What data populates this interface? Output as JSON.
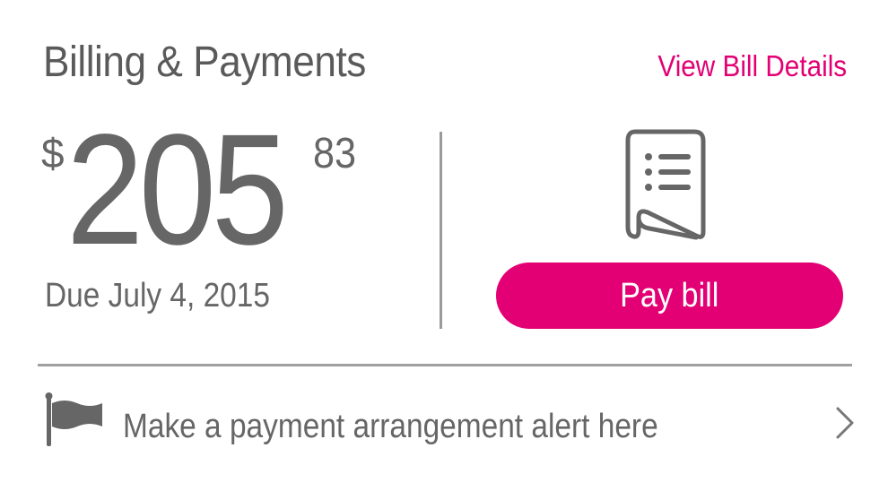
{
  "header": {
    "title": "Billing & Payments",
    "view_details_label": "View Bill Details"
  },
  "balance": {
    "currency_symbol": "$",
    "dollars": "205",
    "cents": "83",
    "due_text": "Due July 4, 2015"
  },
  "actions": {
    "pay_label": "Pay bill",
    "bill_icon": "bill-document-icon"
  },
  "alert": {
    "text": "Make a payment arrangement alert here",
    "icon": "flag-icon",
    "chevron": "chevron-right-icon"
  },
  "colors": {
    "accent": "#e20074",
    "text": "#666666",
    "divider": "#a0a0a0",
    "background": "#ffffff"
  }
}
